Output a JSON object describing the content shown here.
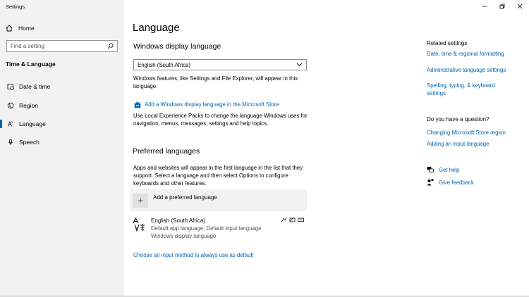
{
  "window": {
    "title": "Settings"
  },
  "sidebar": {
    "home_label": "Home",
    "search_placeholder": "Find a setting",
    "section_title": "Time & Language",
    "items": [
      {
        "label": "Date & time",
        "icon": "clock-icon"
      },
      {
        "label": "Region",
        "icon": "globe-icon"
      },
      {
        "label": "Language",
        "icon": "language-icon",
        "selected": true
      },
      {
        "label": "Speech",
        "icon": "microphone-icon"
      }
    ]
  },
  "main": {
    "title": "Language",
    "display_language": {
      "heading": "Windows display language",
      "selected_value": "English (South Africa)",
      "description": "Windows features, like Settings and File Explorer, will appear in this language.",
      "store_link": "Add a Windows display language in the Microsoft Store",
      "store_description": "Use Local Experience Packs to change the language Windows uses for navigation, menus, messages, settings and help topics."
    },
    "preferred": {
      "heading": "Preferred languages",
      "description": "Apps and websites will appear in the first language in the list that they support. Select a language and then select Options to configure keyboards and other features.",
      "add_label": "Add a preferred language",
      "languages": [
        {
          "name": "English (South Africa)",
          "line1": "Default app language; Default input language",
          "line2": "Windows display language"
        }
      ],
      "input_method_link": "Choose an input method to always use as default"
    }
  },
  "related": {
    "heading": "Related settings",
    "links": [
      "Date, time & regional formatting",
      "Administrative language settings",
      "Spelling, typing, & keyboard settings"
    ],
    "question_heading": "Do you have a question?",
    "question_links": [
      "Changing Microsoft Store region",
      "Adding an input language"
    ],
    "get_help": "Get help",
    "give_feedback": "Give feedback"
  }
}
